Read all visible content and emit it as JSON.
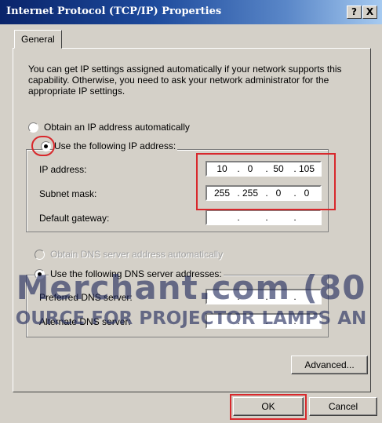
{
  "window": {
    "title": "Internet Protocol (TCP/IP) Properties",
    "help_label": "?",
    "close_label": "X"
  },
  "tabs": [
    {
      "label": "General"
    }
  ],
  "intro_text": "You can get IP settings assigned automatically if your network supports this capability. Otherwise, you need to ask your network administrator for the appropriate IP settings.",
  "ip_section": {
    "option_auto": "Obtain an IP address automatically",
    "option_manual": "Use the following IP address:",
    "selected": "manual",
    "fields": {
      "ip_address": {
        "label": "IP address:",
        "value": [
          "10",
          "0",
          "50",
          "105"
        ]
      },
      "subnet_mask": {
        "label": "Subnet mask:",
        "value": [
          "255",
          "255",
          "0",
          "0"
        ]
      },
      "default_gateway": {
        "label": "Default gateway:",
        "value": [
          "",
          "",
          "",
          ""
        ]
      }
    }
  },
  "dns_section": {
    "option_auto": "Obtain DNS server address automatically",
    "option_manual": "Use the following DNS server addresses:",
    "selected": "manual",
    "fields": {
      "preferred": {
        "label": "Preferred DNS server:",
        "value": [
          "",
          "",
          "",
          ""
        ]
      },
      "alternate": {
        "label": "Alternate DNS server:",
        "value": [
          "",
          "",
          "",
          ""
        ]
      }
    }
  },
  "buttons": {
    "advanced": "Advanced...",
    "ok": "OK",
    "cancel": "Cancel"
  },
  "watermark": {
    "line1": "Merchant.com (80",
    "line2": "OURCE FOR PROJECTOR LAMPS AN"
  },
  "colors": {
    "title_bar_start": "#0a246a",
    "title_bar_end": "#a6caf0",
    "dialog_face": "#d4d0c8",
    "highlight_red": "#d8282c"
  },
  "icons": {
    "help": "question-mark",
    "close": "x-mark"
  }
}
